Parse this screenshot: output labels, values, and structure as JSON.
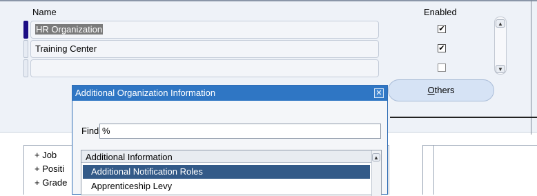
{
  "form": {
    "col_name": "Name",
    "col_enabled": "Enabled",
    "rows": [
      {
        "name": "HR Organization",
        "enabled": true,
        "checkmark": "✔"
      },
      {
        "name": "Training Center",
        "enabled": true,
        "checkmark": "✔"
      },
      {
        "name": "",
        "enabled": false,
        "checkmark": ""
      }
    ],
    "others_label": "Others",
    "others_mnemonic": "O",
    "others_rest": "thers"
  },
  "tree": {
    "items": [
      "+ Job",
      "+ Positi",
      "+ Grade"
    ]
  },
  "dialog": {
    "title": "Additional Organization Information",
    "close_glyph": "✕",
    "find_label": "Find",
    "find_value": "%",
    "list_header": "Additional Information",
    "items": [
      "Additional Notification Roles",
      "Apprenticeship Levy"
    ],
    "selected_index": 0
  }
}
